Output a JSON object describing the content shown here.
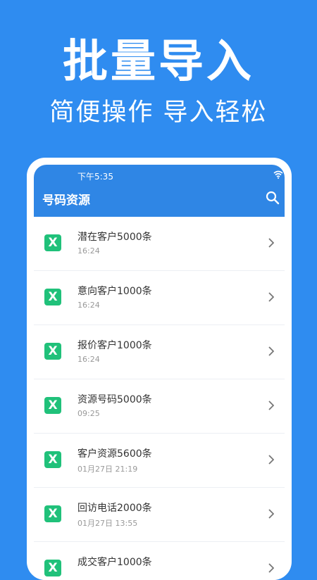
{
  "hero": {
    "title": "批量导入",
    "subtitle": "简便操作 导入轻松"
  },
  "status_bar": {
    "time": "下午5:35"
  },
  "app_bar": {
    "title": "号码资源"
  },
  "file_icon_letter": "X",
  "files": [
    {
      "name": "潜在客户5000条",
      "time": "16:24"
    },
    {
      "name": "意向客户1000条",
      "time": "16:24"
    },
    {
      "name": "报价客户1000条",
      "time": "16:24"
    },
    {
      "name": "资源号码5000条",
      "time": "09:25"
    },
    {
      "name": "客户资源5600条",
      "time": "01月27日 21:19"
    },
    {
      "name": "回访电话2000条",
      "time": "01月27日 13:55"
    },
    {
      "name": "成交客户1000条",
      "time": ""
    }
  ],
  "colors": {
    "background": "#2f8cf0",
    "app_bar": "#2f86e5",
    "excel_icon": "#20c17a"
  }
}
